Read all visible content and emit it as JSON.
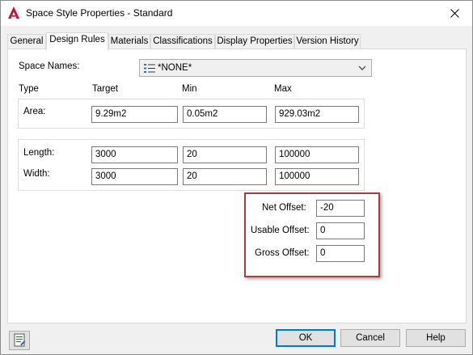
{
  "window": {
    "title": "Space Style Properties - Standard",
    "app_icon": "autocad-a-icon",
    "close_icon": "close-icon"
  },
  "tabs": [
    {
      "label": "General"
    },
    {
      "label": "Design Rules"
    },
    {
      "label": "Materials"
    },
    {
      "label": "Classifications"
    },
    {
      "label": "Display Properties"
    },
    {
      "label": "Version History"
    }
  ],
  "space_names": {
    "label": "Space Names:",
    "value": "*NONE*"
  },
  "columns": {
    "type": "Type",
    "target": "Target",
    "min": "Min",
    "max": "Max"
  },
  "area": {
    "label": "Area:",
    "target": "9.29m2",
    "min": "0.05m2",
    "max": "929.03m2"
  },
  "length": {
    "label": "Length:",
    "target": "3000",
    "min": "20",
    "max": "100000"
  },
  "width": {
    "label": "Width:",
    "target": "3000",
    "min": "20",
    "max": "100000"
  },
  "offsets": {
    "net_label": "Net Offset:",
    "net_value": "-20",
    "usable_label": "Usable Offset:",
    "usable_value": "0",
    "gross_label": "Gross Offset:",
    "gross_value": "0"
  },
  "buttons": {
    "ok": "OK",
    "cancel": "Cancel",
    "help": "Help"
  },
  "colors": {
    "highlight": "#b2373f",
    "default_button_border": "#0078d7",
    "app_icon": "#c8102e"
  }
}
